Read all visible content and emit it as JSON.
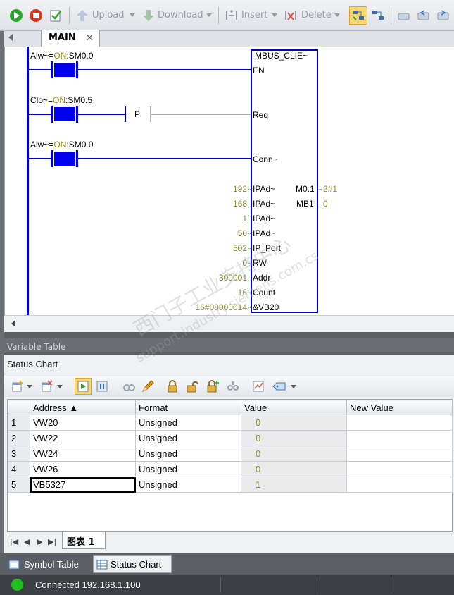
{
  "toolbar": {
    "upload_label": "Upload",
    "download_label": "Download",
    "insert_label": "Insert",
    "delete_label": "Delete",
    "icons": [
      "run-icon",
      "stop-icon",
      "compile-icon",
      "upload-icon",
      "download-icon",
      "insert-icon",
      "delete-icon",
      "program-status-icon",
      "chart-status-icon",
      "toggle-icon",
      "back-icon",
      "forward-icon"
    ]
  },
  "editor_tab": {
    "label": "MAIN",
    "close": "×"
  },
  "ladder": {
    "rung1": {
      "prefix": "Alw~=",
      "on": "ON",
      "suffix": ":SM0.0"
    },
    "rung2": {
      "prefix": "Clo~=",
      "on": "ON",
      "suffix": ":SM0.5",
      "p_label": "P"
    },
    "rung3": {
      "prefix": "Alw~=",
      "on": "ON",
      "suffix": ":SM0.0"
    },
    "block": {
      "title": "MBUS_CLIE~",
      "inputs": [
        {
          "pin": "EN",
          "value": ""
        },
        {
          "pin": "Req",
          "value": ""
        },
        {
          "pin": "Conn~",
          "value": ""
        },
        {
          "pin": "IPAd~",
          "value": "192"
        },
        {
          "pin": "IPAd~",
          "value": "168"
        },
        {
          "pin": "IPAd~",
          "value": "1"
        },
        {
          "pin": "IPAd~",
          "value": "50"
        },
        {
          "pin": "IP_Port",
          "value": "502"
        },
        {
          "pin": "RW",
          "value": "0"
        },
        {
          "pin": "Addr",
          "value": "300001"
        },
        {
          "pin": "Count",
          "value": "16"
        },
        {
          "pin": "&VB20",
          "value": "16#08000014"
        }
      ],
      "outputs": [
        {
          "pin": "M0.1",
          "value": "2#1"
        },
        {
          "pin": "MB1",
          "value": "0"
        }
      ]
    }
  },
  "variable_table": {
    "title": "Variable Table"
  },
  "status_chart": {
    "title": "Status Chart",
    "columns": [
      "Address ▲",
      "Format",
      "Value",
      "New Value"
    ],
    "rows": [
      {
        "n": "1",
        "address": "VW20",
        "format": "Unsigned",
        "value": "0",
        "new_value": ""
      },
      {
        "n": "2",
        "address": "VW22",
        "format": "Unsigned",
        "value": "0",
        "new_value": ""
      },
      {
        "n": "3",
        "address": "VW24",
        "format": "Unsigned",
        "value": "0",
        "new_value": ""
      },
      {
        "n": "4",
        "address": "VW26",
        "format": "Unsigned",
        "value": "0",
        "new_value": ""
      },
      {
        "n": "5",
        "address": "VB5327",
        "format": "Unsigned",
        "value": "1",
        "new_value": ""
      }
    ],
    "sheet_tab": "图表 1"
  },
  "bottom_tabs": {
    "symbol_table": "Symbol Table",
    "status_chart": "Status Chart"
  },
  "status_bar": {
    "connection": "Connected 192.168.1.100"
  },
  "watermark": {
    "line1": "西门子工业支持中心",
    "line2": "support.industry.siemens.com.cs"
  },
  "colors": {
    "accent": "#0000cc",
    "contact": "#0000ee",
    "on_text": "#9a8a00",
    "connected": "#1fbf1f"
  }
}
